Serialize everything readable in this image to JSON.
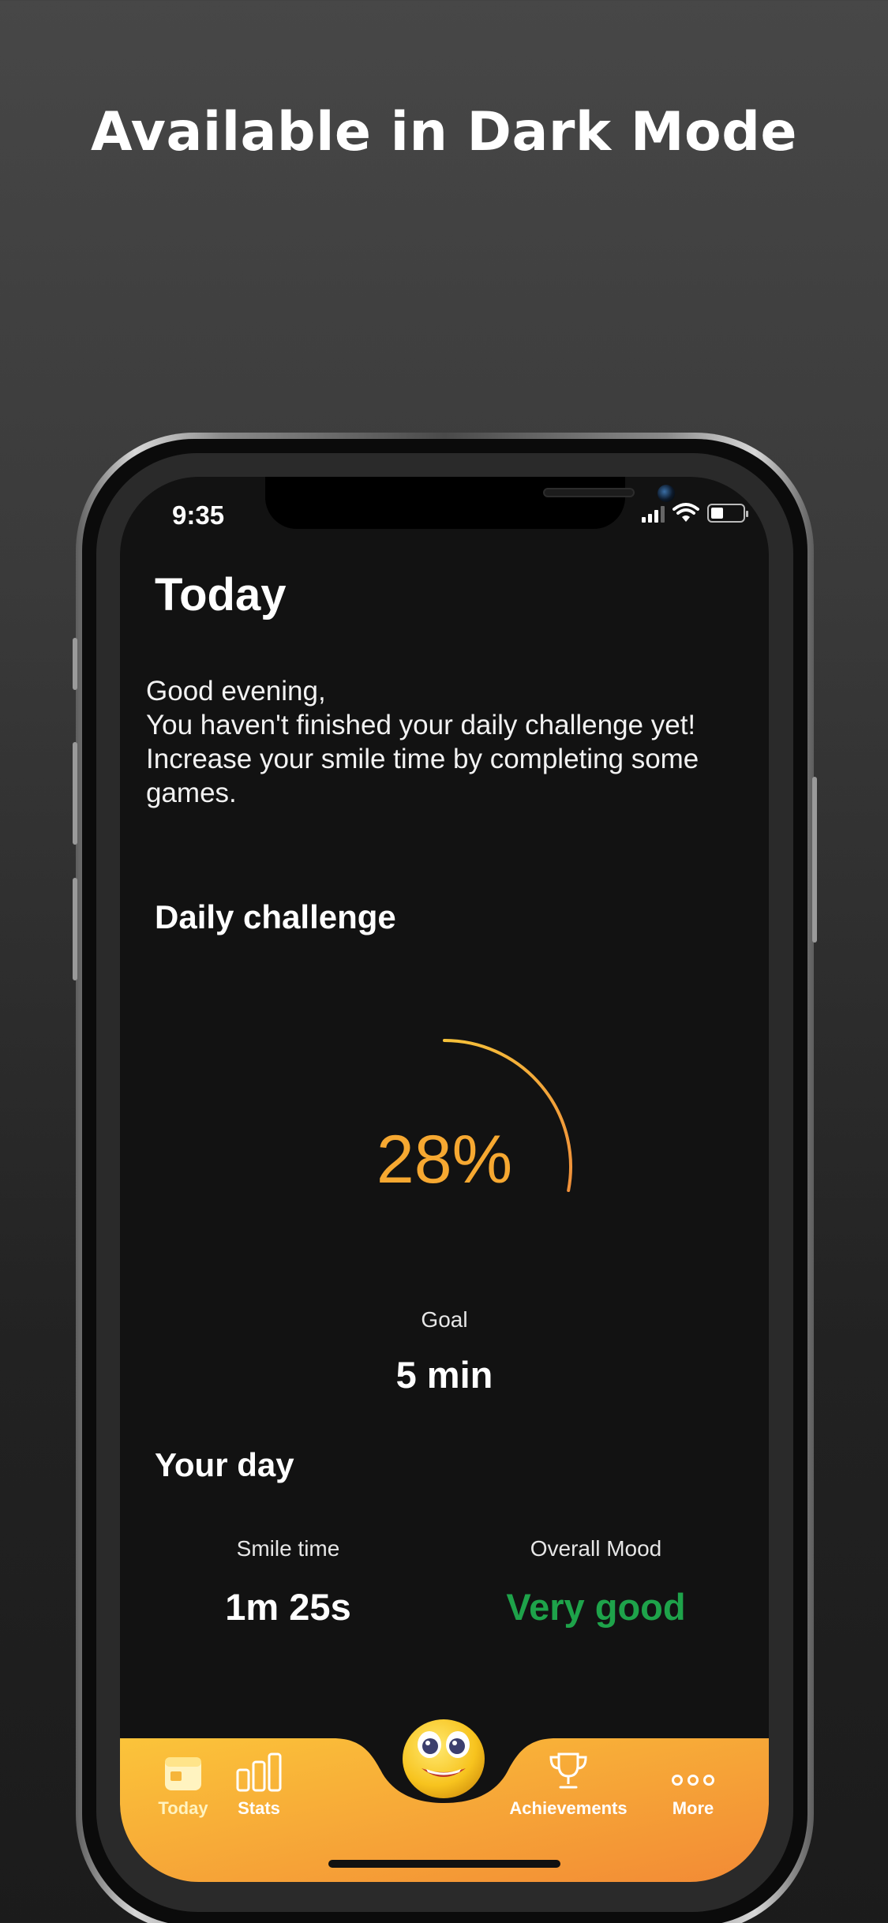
{
  "headline": "Available in Dark Mode",
  "status_bar": {
    "time": "9:35",
    "battery_level": 0.4
  },
  "screen_title": "Today",
  "greeting": {
    "line1": "Good evening,",
    "line2": "You haven't finished your daily challenge yet!",
    "line3": "Increase your smile time by completing some games."
  },
  "daily_challenge": {
    "title": "Daily challenge",
    "percent_label": "28%",
    "progress": 0.28,
    "goal_label": "Goal",
    "goal_value": "5 min",
    "ring_color_start": "#f6c23a",
    "ring_color_end": "#f0903a"
  },
  "your_day": {
    "title": "Your day",
    "smile_time_label": "Smile time",
    "smile_time_value": "1m 25s",
    "mood_label": "Overall Mood",
    "mood_value": "Very good",
    "mood_color": "#1ea34a"
  },
  "tabbar": {
    "gradient_start": "#fbc43a",
    "gradient_end": "#f28a35",
    "tabs": [
      {
        "label": "Today",
        "icon": "calendar-icon"
      },
      {
        "label": "Stats",
        "icon": "bar-chart-icon"
      },
      {
        "label": "Achievements",
        "icon": "trophy-icon"
      },
      {
        "label": "More",
        "icon": "more-dots-icon"
      }
    ],
    "center_icon": "smiley-mascot-icon"
  }
}
